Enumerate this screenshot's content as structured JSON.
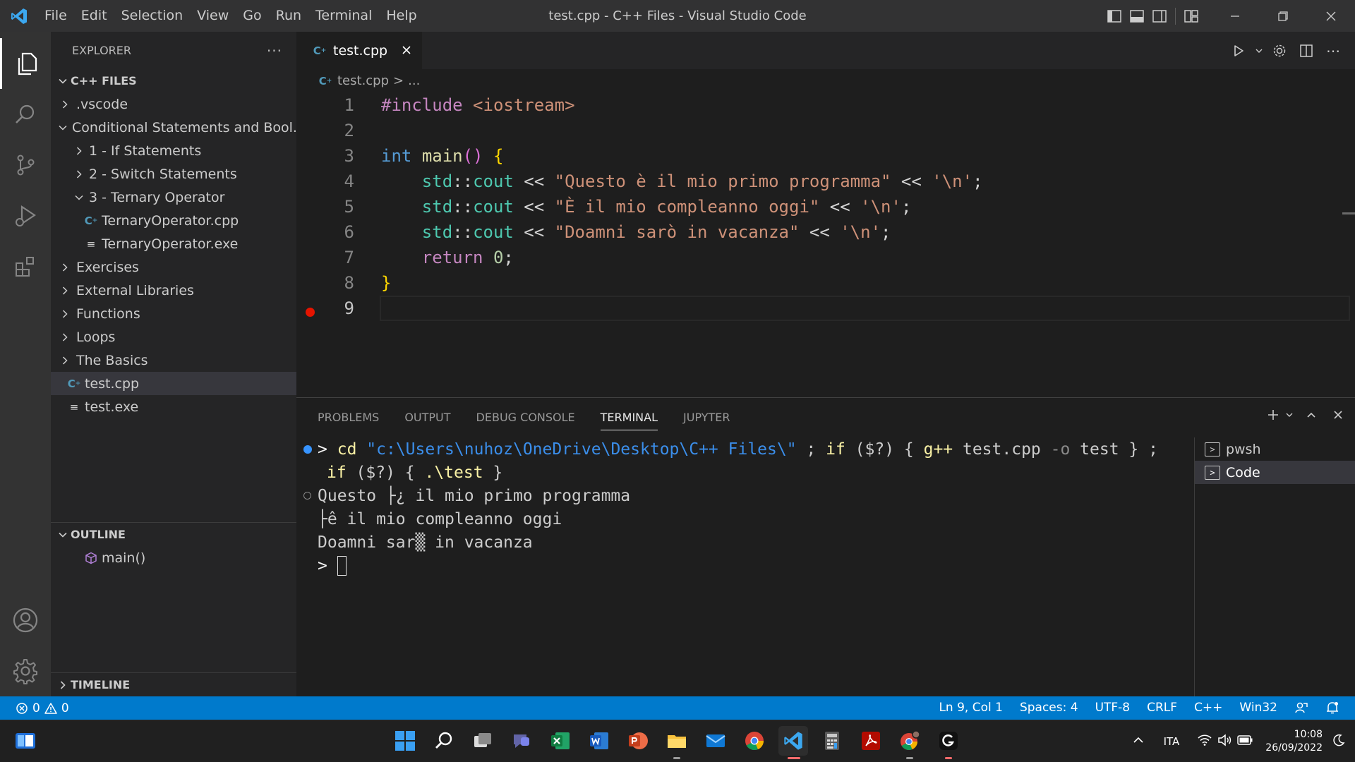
{
  "window": {
    "title": "test.cpp - C++ Files - Visual Studio Code",
    "menu": [
      "File",
      "Edit",
      "Selection",
      "View",
      "Go",
      "Run",
      "Terminal",
      "Help"
    ]
  },
  "activity_bar": [
    "explorer-icon",
    "search-icon",
    "source-control-icon",
    "run-debug-icon",
    "extensions-icon",
    "accounts-icon",
    "manage-gear-icon"
  ],
  "sidebar": {
    "header": "EXPLORER",
    "more": "···",
    "workspace": "C++ FILES",
    "items": [
      {
        "label": ".vscode"
      },
      {
        "label": "Conditional Statements and Bool..."
      },
      {
        "label": "1 - If Statements"
      },
      {
        "label": "2 - Switch Statements"
      },
      {
        "label": "3 - Ternary Operator"
      },
      {
        "label": "TernaryOperator.cpp"
      },
      {
        "label": "TernaryOperator.exe"
      },
      {
        "label": "Exercises"
      },
      {
        "label": "External Libraries"
      },
      {
        "label": "Functions"
      },
      {
        "label": "Loops"
      },
      {
        "label": "The Basics"
      },
      {
        "label": "test.cpp"
      },
      {
        "label": "test.exe"
      }
    ],
    "outline": {
      "header": "OUTLINE",
      "items": [
        "main()"
      ]
    },
    "timeline": {
      "header": "TIMELINE"
    }
  },
  "editor": {
    "tab": "test.cpp",
    "breadcrumb": [
      "test.cpp",
      ">",
      "..."
    ],
    "line_numbers": [
      "1",
      "2",
      "3",
      "4",
      "5",
      "6",
      "7",
      "8",
      "9"
    ],
    "lines": [
      [
        "#include",
        " ",
        "<iostream>"
      ],
      [],
      [
        "int",
        " ",
        "main",
        "()",
        " ",
        "{"
      ],
      [
        "    ",
        "std",
        "::",
        "cout",
        " << ",
        "\"Questo è il mio primo programma\"",
        " << ",
        "'\\n'",
        ";"
      ],
      [
        "    ",
        "std",
        "::",
        "cout",
        " << ",
        "\"È il mio compleanno oggi\"",
        " << ",
        "'\\n'",
        ";"
      ],
      [
        "    ",
        "std",
        "::",
        "cout",
        " << ",
        "\"Doamni sarò in vacanza\"",
        " << ",
        "'\\n'",
        ";"
      ],
      [
        "    ",
        "return",
        " ",
        "0",
        ";"
      ],
      [
        "}"
      ],
      []
    ],
    "breakpoint_line": "9"
  },
  "panel": {
    "tabs": [
      "PROBLEMS",
      "OUTPUT",
      "DEBUG CONSOLE",
      "TERMINAL",
      "JUPYTER"
    ],
    "active_tab": "TERMINAL",
    "terminal": {
      "cmd": {
        "prompt": ">",
        "cd": "cd",
        "path": "\"c:\\Users\\nuhoz\\OneDrive\\Desktop\\C++ Files\\\"",
        "sep1": " ; ",
        "if1": "if",
        "cond": " ($?) { ",
        "gpp": "g++",
        "args": " test.cpp ",
        "flag": "-o",
        "rest": " test } ;",
        "if2": "if",
        "cond2": " ($?) { ",
        "run": ".\\test",
        "end": " }"
      },
      "output": [
        "Questo ├¿ il mio primo programma",
        "├ê il mio compleanno oggi",
        "Doamni sar▒ in vacanza"
      ],
      "prompt2": ">"
    },
    "terminal_list": [
      "pwsh",
      "Code"
    ]
  },
  "status_bar": {
    "errors": "0",
    "warnings": "0",
    "position": "Ln 9, Col 1",
    "spaces": "Spaces: 4",
    "encoding": "UTF-8",
    "eol": "CRLF",
    "language": "C++",
    "platform": "Win32"
  },
  "taskbar": {
    "apps": [
      "windows-start-icon",
      "search-icon",
      "task-view-icon",
      "chat-icon",
      "excel-icon",
      "word-icon",
      "powerpoint-icon",
      "file-explorer-icon",
      "mail-icon",
      "chrome-icon",
      "vscode-icon",
      "calculator-icon",
      "acrobat-icon",
      "chrome-profile-icon",
      "logitech-icon"
    ],
    "language": "ITA",
    "time": "10:08",
    "date": "26/09/2022"
  },
  "colors": {
    "accent": "#007acc",
    "titlebar": "#323233",
    "sidebar": "#252526",
    "editor_bg": "#1e1e1e",
    "breakpoint": "#e51400"
  }
}
